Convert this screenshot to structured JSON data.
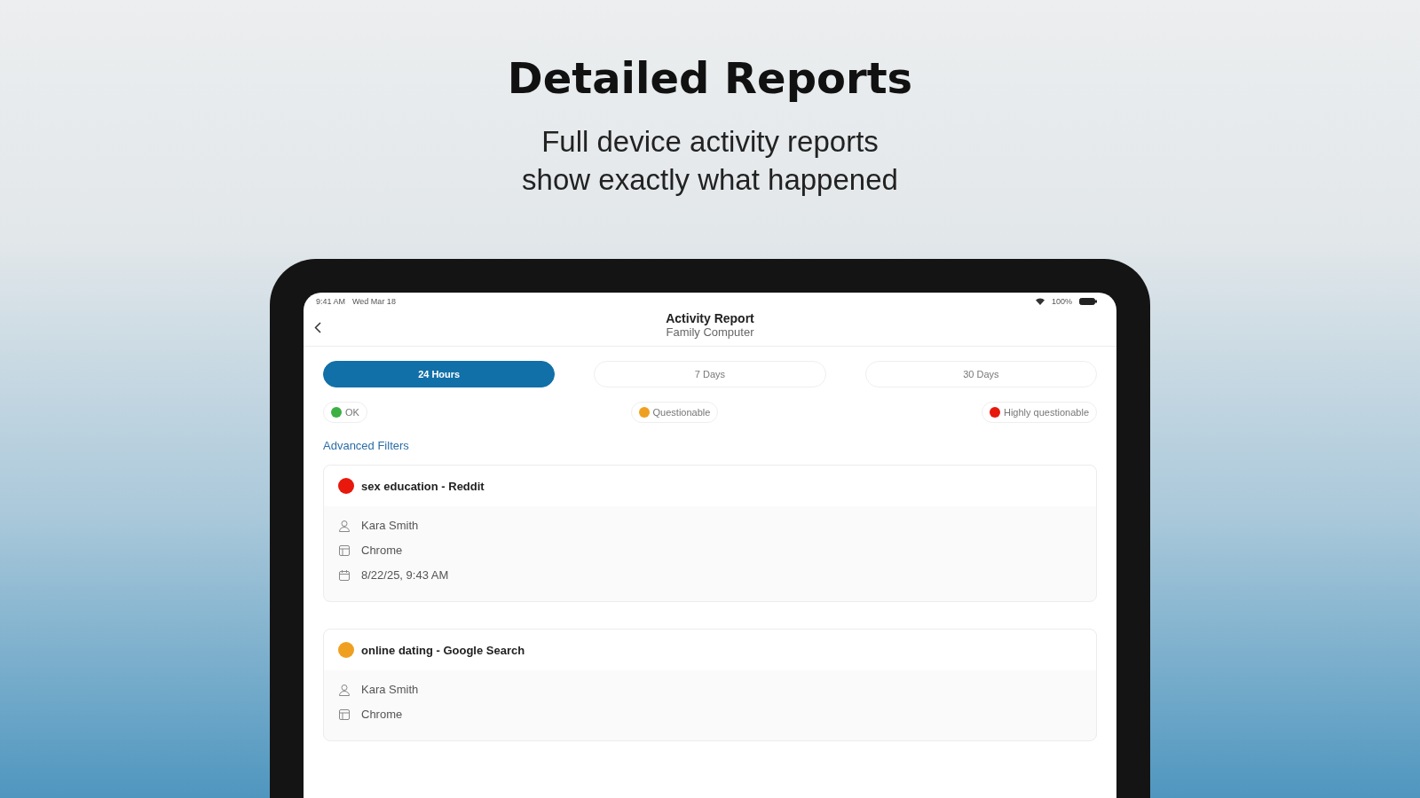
{
  "headline": "Detailed Reports",
  "subheadline": [
    "Full device activity reports",
    "show exactly what happened"
  ],
  "status_bar": {
    "time": "9:41 AM",
    "date": "Wed Mar 18",
    "battery_text": "100%"
  },
  "nav": {
    "title": "Activity Report",
    "subtitle": "Family Computer"
  },
  "tabs": [
    {
      "label": "24 Hours",
      "selected": true
    },
    {
      "label": "7 Days",
      "selected": false
    },
    {
      "label": "30 Days",
      "selected": false
    }
  ],
  "legend": [
    {
      "label": "OK",
      "color": "#3cb043"
    },
    {
      "label": "Questionable",
      "color": "#f0a020"
    },
    {
      "label": "Highly questionable",
      "color": "#e8180c"
    }
  ],
  "advanced_filters": "Advanced Filters",
  "activities": [
    {
      "title": "sex education - Reddit",
      "color": "#e8180c",
      "user": "Kara Smith",
      "app": "Chrome",
      "time": "8/22/25, 9:43 AM"
    },
    {
      "title": "online dating - Google Search",
      "color": "#f0a020",
      "user": "Kara Smith",
      "app": "Chrome"
    }
  ]
}
